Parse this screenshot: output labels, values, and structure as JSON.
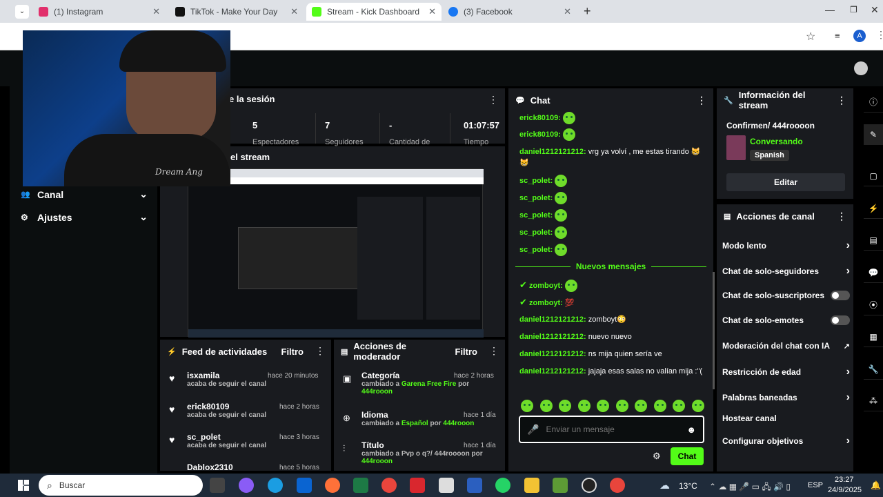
{
  "tabs": [
    {
      "title": "(1) Instagram",
      "color": "#e1306c"
    },
    {
      "title": "TikTok - Make Your Day",
      "color": "#111111"
    },
    {
      "title": "Stream - Kick Dashboard",
      "color": "#53fc18"
    },
    {
      "title": "(3) Facebook",
      "color": "#1877f2"
    }
  ],
  "avatar_letter": "A",
  "session": {
    "title": "e la sesión",
    "stats": [
      "5",
      "7",
      "-",
      "01:07:57"
    ],
    "labels": [
      "Espectadores",
      "Seguidores",
      "Cantidad de",
      "Tiempo"
    ]
  },
  "stream_preview": {
    "title": "el stream"
  },
  "webcam_text": "Dream Ang",
  "sidebar": [
    {
      "label": "Canal"
    },
    {
      "label": "Ajustes"
    }
  ],
  "chat": {
    "title": "Chat",
    "messages": [
      {
        "user": "erick80109:",
        "text": ""
      },
      {
        "user": "erick80109:",
        "text": ""
      },
      {
        "user": "daniel1212121212:",
        "text": " vrg ya volví , me estas tirando 😸😸"
      },
      {
        "user": "sc_polet:",
        "text": ""
      },
      {
        "user": "sc_polet:",
        "text": ""
      },
      {
        "user": "sc_polet:",
        "text": ""
      },
      {
        "user": "sc_polet:",
        "text": ""
      },
      {
        "user": "sc_polet:",
        "text": ""
      }
    ],
    "new_messages": "Nuevos mensajes",
    "messages2": [
      {
        "user": "zomboyt:",
        "text": ""
      },
      {
        "user": "zomboyt:",
        "text": " 💯"
      },
      {
        "user": "daniel1212121212:",
        "text": " zomboyt😳"
      },
      {
        "user": "daniel1212121212:",
        "text": " nuevo nuevo"
      },
      {
        "user": "daniel1212121212:",
        "text": " ns mija quien sería ve"
      },
      {
        "user": "daniel1212121212:",
        "text": " jajaja esas salas no valían mija :\"("
      }
    ],
    "placeholder": "Enviar un mensaje",
    "send": "Chat"
  },
  "stream_info": {
    "title": "Información del stream",
    "stream_title": "Confirmen/ 444roooon",
    "category": "Conversando",
    "language": "Spanish",
    "edit": "Editar"
  },
  "channel_actions": {
    "title": "Acciones de canal",
    "items": [
      "Modo lento",
      "Chat de solo-seguidores",
      "Chat de solo-suscriptores",
      "Chat de solo-emotes",
      "Moderación del chat con IA",
      "Restricción de edad",
      "Palabras baneadas",
      "Hostear canal",
      "Configurar objetivos"
    ]
  },
  "activity": {
    "title": "Feed de actividades",
    "filter": "Filtro",
    "items": [
      {
        "user": "isxamila",
        "action": "acaba de seguir el canal",
        "time": "hace 20 minutos"
      },
      {
        "user": "erick80109",
        "action": "acaba de seguir el canal",
        "time": "hace 2 horas"
      },
      {
        "user": "sc_polet",
        "action": "acaba de seguir el canal",
        "time": "hace 3 horas"
      },
      {
        "user": "Dablox2310",
        "action": "",
        "time": "hace 5 horas"
      }
    ]
  },
  "modactions": {
    "title": "Acciones de moderador",
    "filter": "Filtro",
    "items": [
      {
        "kind": "Categoría",
        "pre": "cambiado a ",
        "value": "Garena Free Fire",
        "by": " por ",
        "who": "444rooon",
        "time": "hace 2 horas"
      },
      {
        "kind": "Idioma",
        "pre": "cambiado a ",
        "value": "Español",
        "by": " por ",
        "who": "444rooon",
        "time": "hace 1 día"
      },
      {
        "kind": "Título",
        "pre": "cambiado a ",
        "value": "Pvp o q?/ 444roooon",
        "by": " por ",
        "who": "444rooon",
        "time": "hace 1 día"
      }
    ]
  },
  "taskbar": {
    "search": "Buscar",
    "temp": "13°C",
    "lang": "ESP",
    "time": "23:27",
    "date": "24/9/2025"
  }
}
